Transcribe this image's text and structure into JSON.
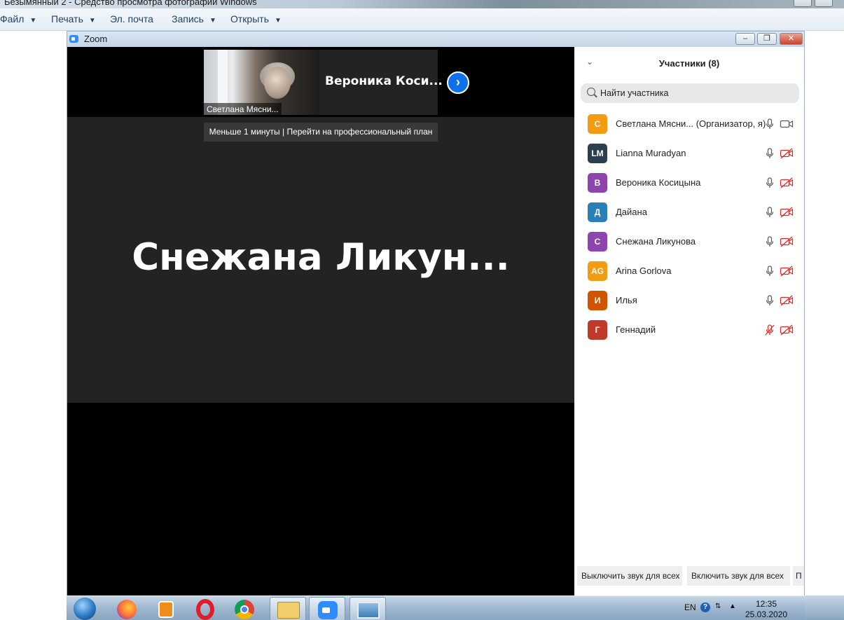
{
  "outer_window": {
    "title": "Безымянный 2 - Средство просмотра фотографий Windows"
  },
  "menubar": {
    "items": [
      {
        "label": "Файл",
        "has_arrow": true
      },
      {
        "label": "Печать",
        "has_arrow": true
      },
      {
        "label": "Эл. почта",
        "has_arrow": false
      },
      {
        "label": "Запись",
        "has_arrow": true
      },
      {
        "label": "Открыть",
        "has_arrow": true
      }
    ]
  },
  "zoom_window": {
    "title": "Zoom",
    "controls": {
      "minimize": "–",
      "restore": "❐",
      "close": "✕"
    }
  },
  "meeting": {
    "thumbnail_label": "Светлана Мясни...",
    "thumbnail_next_name": "Вероника  Коси...",
    "time_banner": "Меньше 1 минуты | Перейти на профессиональный план",
    "active_speaker": "Снежана  Ликун..."
  },
  "participants_panel": {
    "title": "Участники (8)",
    "search_placeholder": "Найти участника",
    "participants": [
      {
        "initials": "С",
        "name": "Светлана Мясни...  (Организатор, я)",
        "color": "#f39c12",
        "mic_muted": false,
        "video_off": false
      },
      {
        "initials": "LM",
        "name": "Lianna Muradyan",
        "color": "#2c3e50",
        "mic_muted": false,
        "video_off": true
      },
      {
        "initials": "В",
        "name": "Вероника Косицына",
        "color": "#8e44ad",
        "mic_muted": false,
        "video_off": true
      },
      {
        "initials": "Д",
        "name": "Дайана",
        "color": "#2980b9",
        "mic_muted": false,
        "video_off": true
      },
      {
        "initials": "С",
        "name": "Снежана Ликунова",
        "color": "#8e44ad",
        "mic_muted": false,
        "video_off": true
      },
      {
        "initials": "AG",
        "name": "Arina Gorlova",
        "color": "#f39c12",
        "mic_muted": false,
        "video_off": true
      },
      {
        "initials": "И",
        "name": "Илья",
        "color": "#d35400",
        "mic_muted": false,
        "video_off": true
      },
      {
        "initials": "Г",
        "name": "Геннадий",
        "color": "#c0392b",
        "mic_muted": true,
        "video_off": true
      }
    ],
    "footer_buttons": [
      "Выключить звук для всех",
      "Включить звук для всех",
      "П"
    ]
  },
  "taskbar": {
    "apps": [
      "start-button",
      "firefox-icon",
      "media-player-icon",
      "opera-icon",
      "chrome-icon",
      "file-explorer-icon",
      "zoom-icon",
      "photo-viewer-icon"
    ],
    "lang": "EN",
    "time": "12:35",
    "date": "25.03.2020"
  },
  "colors": {
    "zoom_blue": "#0e71eb",
    "muted_red": "#e02828",
    "stage_dark": "#232323"
  }
}
